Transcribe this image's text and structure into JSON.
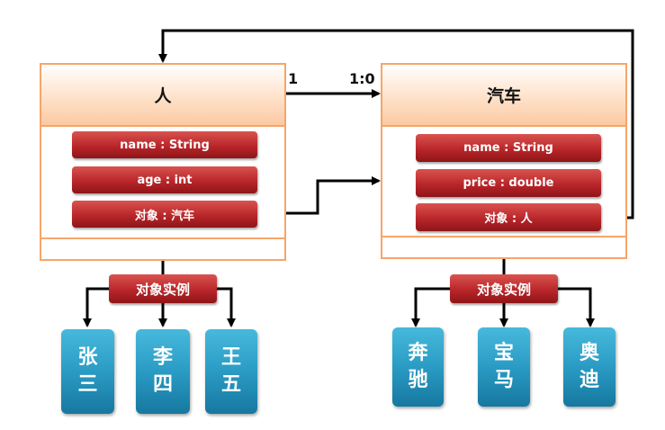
{
  "person_class": {
    "title": "人",
    "attributes": [
      "name : String",
      "age : int",
      "对象 : 汽车"
    ],
    "instances_label": "对象实例",
    "instances": [
      "张三",
      "李四",
      "王五"
    ]
  },
  "car_class": {
    "title": "汽车",
    "attributes": [
      "name : String",
      "price : double",
      "对象 : 人"
    ],
    "instances_label": "对象实例",
    "instances": [
      "奔驰",
      "宝马",
      "奥迪"
    ]
  },
  "association": {
    "left_multiplicity": "1",
    "right_multiplicity": "1:0"
  },
  "colors": {
    "class_border": "#f6a56a",
    "attribute_fill": "#b9262a",
    "instance_fill": "#2a9bc4",
    "connector": "#000000"
  }
}
